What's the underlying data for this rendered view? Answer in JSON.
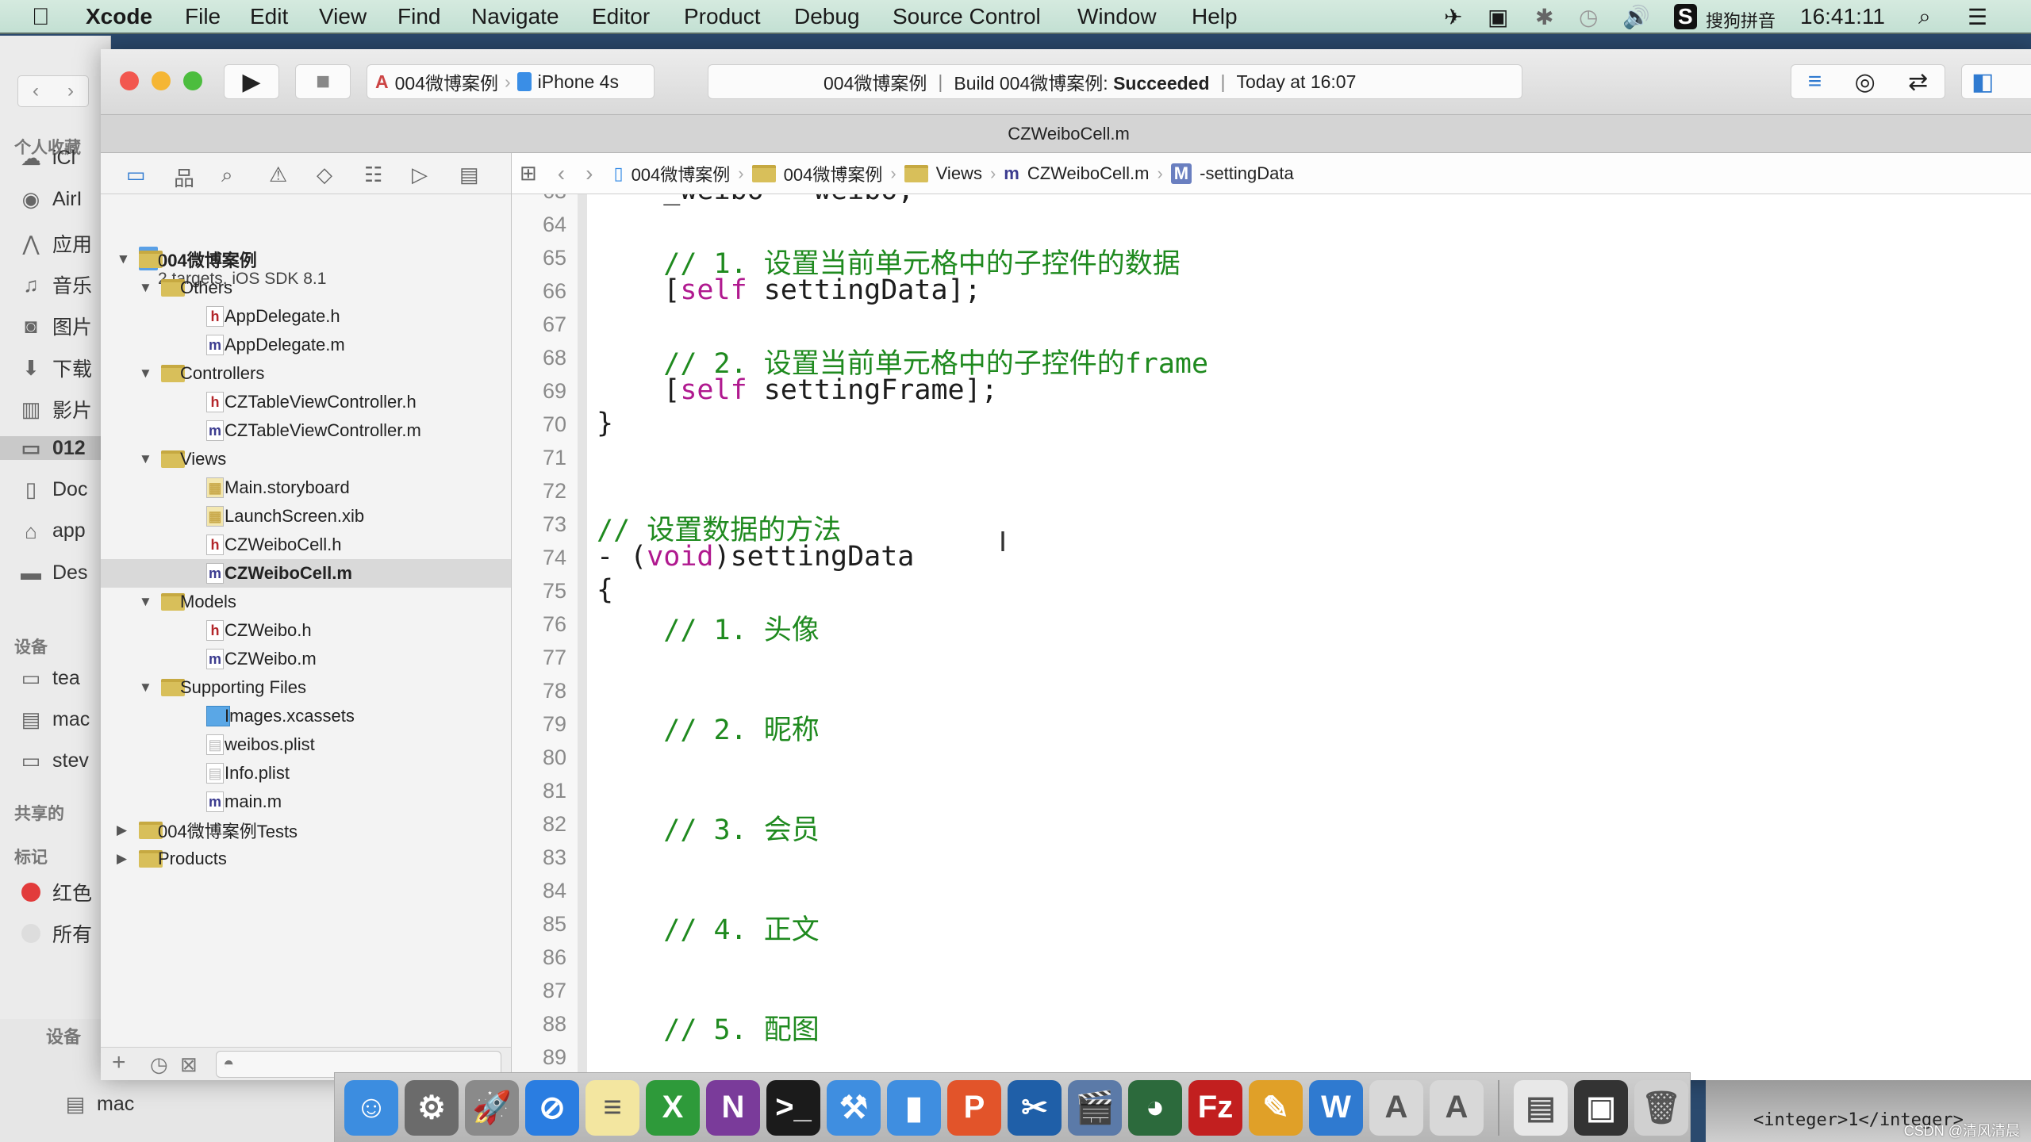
{
  "menubar": {
    "apple": "",
    "items": [
      "Xcode",
      "File",
      "Edit",
      "View",
      "Find",
      "Navigate",
      "Editor",
      "Product",
      "Debug",
      "Source Control",
      "Window",
      "Help"
    ],
    "input_method": "搜狗拼音",
    "clock": "16:41:11",
    "status_icons": [
      "airplane-icon",
      "screen-record-icon",
      "bluetooth-icon",
      "time-machine-icon",
      "volume-icon",
      "sogou-icon",
      "spotlight-icon",
      "notification-center-icon"
    ]
  },
  "finder_sidebar": {
    "favorites_header": "个人收藏",
    "favorites": [
      {
        "label": "iCl",
        "icon": "cloud-icon"
      },
      {
        "label": "AirI",
        "icon": "airdrop-icon"
      },
      {
        "label": "应用",
        "icon": "applications-icon"
      },
      {
        "label": "音乐",
        "icon": "music-icon"
      },
      {
        "label": "图片",
        "icon": "camera-icon"
      },
      {
        "label": "下载",
        "icon": "download-icon"
      },
      {
        "label": "影片",
        "icon": "film-icon"
      },
      {
        "label": "012",
        "icon": "folder-icon",
        "selected": true
      },
      {
        "label": "Doc",
        "icon": "documents-icon"
      },
      {
        "label": "app",
        "icon": "home-icon"
      },
      {
        "label": "Des",
        "icon": "desktop-icon"
      }
    ],
    "devices_header": "设备",
    "devices": [
      {
        "label": "tea",
        "icon": "monitor-icon"
      },
      {
        "label": "mac",
        "icon": "disk-icon"
      },
      {
        "label": "stev",
        "icon": "drive-icon"
      }
    ],
    "shared_header": "共享的",
    "tags_header": "标记",
    "tags": [
      {
        "label": "红色",
        "color": "#e23b3b"
      },
      {
        "label": "所有",
        "color": "#dddddd"
      }
    ]
  },
  "finder_window2": {
    "devices_header": "设备",
    "device": "mac"
  },
  "toolbar": {
    "scheme": "004微博案例",
    "device": "iPhone 4s",
    "status_project": "004微博案例",
    "status_build_prefix": "Build 004微博案例: ",
    "status_build_result": "Succeeded",
    "status_time": "Today at 16:07"
  },
  "tab_title": "CZWeiboCell.m",
  "jumpbar": {
    "items": [
      "004微博案例",
      "004微博案例",
      "Views",
      "CZWeiboCell.m",
      "-settingData"
    ]
  },
  "navigator": {
    "icons": [
      "project-navigator-icon",
      "symbol-navigator-icon",
      "find-navigator-icon",
      "issue-navigator-icon",
      "test-navigator-icon",
      "debug-navigator-icon",
      "breakpoint-navigator-icon",
      "report-navigator-icon"
    ],
    "project": {
      "name": "004微博案例",
      "subtitle": "2 targets, iOS SDK 8.1"
    },
    "rows": [
      {
        "label": "004微博案例",
        "depth": 1,
        "type": "folder",
        "open": true
      },
      {
        "label": "Others",
        "depth": 2,
        "type": "folder",
        "open": true
      },
      {
        "label": "AppDelegate.h",
        "depth": 3,
        "type": "h"
      },
      {
        "label": "AppDelegate.m",
        "depth": 3,
        "type": "m"
      },
      {
        "label": "Controllers",
        "depth": 2,
        "type": "folder",
        "open": true
      },
      {
        "label": "CZTableViewController.h",
        "depth": 3,
        "type": "h"
      },
      {
        "label": "CZTableViewController.m",
        "depth": 3,
        "type": "m"
      },
      {
        "label": "Views",
        "depth": 2,
        "type": "folder",
        "open": true
      },
      {
        "label": "Main.storyboard",
        "depth": 3,
        "type": "ib"
      },
      {
        "label": "LaunchScreen.xib",
        "depth": 3,
        "type": "ib"
      },
      {
        "label": "CZWeiboCell.h",
        "depth": 3,
        "type": "h"
      },
      {
        "label": "CZWeiboCell.m",
        "depth": 3,
        "type": "m",
        "selected": true
      },
      {
        "label": "Models",
        "depth": 2,
        "type": "folder",
        "open": true
      },
      {
        "label": "CZWeibo.h",
        "depth": 3,
        "type": "h"
      },
      {
        "label": "CZWeibo.m",
        "depth": 3,
        "type": "m"
      },
      {
        "label": "Supporting Files",
        "depth": 2,
        "type": "folder",
        "open": true
      },
      {
        "label": "Images.xcassets",
        "depth": 3,
        "type": "assets"
      },
      {
        "label": "weibos.plist",
        "depth": 3,
        "type": "plist"
      },
      {
        "label": "Info.plist",
        "depth": 3,
        "type": "plist"
      },
      {
        "label": "main.m",
        "depth": 3,
        "type": "m"
      },
      {
        "label": "004微博案例Tests",
        "depth": 1,
        "type": "folder",
        "open": false
      },
      {
        "label": "Products",
        "depth": 1,
        "type": "folder",
        "open": false
      }
    ]
  },
  "editor": {
    "lines": [
      {
        "n": "63",
        "t": [
          [
            "p",
            "    _weibo = weibo;"
          ]
        ]
      },
      {
        "n": "64",
        "t": []
      },
      {
        "n": "65",
        "t": [
          [
            "c",
            "    // 1. 设置当前单元格中的子控件的数据"
          ]
        ]
      },
      {
        "n": "66",
        "t": [
          [
            "p",
            "    ["
          ],
          [
            "k",
            "self"
          ],
          [
            "p",
            " settingData];"
          ]
        ]
      },
      {
        "n": "67",
        "t": []
      },
      {
        "n": "68",
        "t": [
          [
            "c",
            "    // 2. 设置当前单元格中的子控件的frame"
          ]
        ]
      },
      {
        "n": "69",
        "t": [
          [
            "p",
            "    ["
          ],
          [
            "k",
            "self"
          ],
          [
            "p",
            " settingFrame];"
          ]
        ]
      },
      {
        "n": "70",
        "t": [
          [
            "p",
            "}"
          ]
        ]
      },
      {
        "n": "71",
        "t": []
      },
      {
        "n": "72",
        "t": []
      },
      {
        "n": "73",
        "t": [
          [
            "c",
            "// 设置数据的方法"
          ]
        ]
      },
      {
        "n": "74",
        "t": [
          [
            "p",
            "- ("
          ],
          [
            "k",
            "void"
          ],
          [
            "p",
            ")settingData"
          ]
        ]
      },
      {
        "n": "75",
        "t": [
          [
            "p",
            "{"
          ]
        ]
      },
      {
        "n": "76",
        "t": [
          [
            "c",
            "    // 1. 头像"
          ]
        ]
      },
      {
        "n": "77",
        "t": []
      },
      {
        "n": "78",
        "t": []
      },
      {
        "n": "79",
        "t": [
          [
            "c",
            "    // 2. 昵称"
          ]
        ]
      },
      {
        "n": "80",
        "t": []
      },
      {
        "n": "81",
        "t": []
      },
      {
        "n": "82",
        "t": [
          [
            "c",
            "    // 3. 会员"
          ]
        ]
      },
      {
        "n": "83",
        "t": []
      },
      {
        "n": "84",
        "t": []
      },
      {
        "n": "85",
        "t": [
          [
            "c",
            "    // 4. 正文"
          ]
        ]
      },
      {
        "n": "86",
        "t": []
      },
      {
        "n": "87",
        "t": []
      },
      {
        "n": "88",
        "t": [
          [
            "c",
            "    // 5. 配图"
          ]
        ]
      },
      {
        "n": "89",
        "t": []
      }
    ]
  },
  "dock": {
    "apps": [
      {
        "name": "finder",
        "glyph": "☺",
        "color": "#3c8de0"
      },
      {
        "name": "system-preferences",
        "glyph": "⚙",
        "color": "#6b6b6b"
      },
      {
        "name": "launchpad",
        "glyph": "🚀",
        "color": "#8a8a8a"
      },
      {
        "name": "safari",
        "glyph": "⊘",
        "color": "#2a7de1"
      },
      {
        "name": "notes",
        "glyph": "≡",
        "color": "#f3e6a0"
      },
      {
        "name": "excel",
        "glyph": "X",
        "color": "#2e9a3a"
      },
      {
        "name": "onenote",
        "glyph": "N",
        "color": "#7a3b9a"
      },
      {
        "name": "terminal",
        "glyph": ">_",
        "color": "#1b1b1b"
      },
      {
        "name": "xcode",
        "glyph": "⚒",
        "color": "#3f8ee0"
      },
      {
        "name": "ios-simulator",
        "glyph": "▮",
        "color": "#3f8ee0"
      },
      {
        "name": "powerpoint",
        "glyph": "P",
        "color": "#e2542a"
      },
      {
        "name": "snip",
        "glyph": "✂",
        "color": "#1f5fa8"
      },
      {
        "name": "photo-booth",
        "glyph": "🎬",
        "color": "#5b7aa8"
      },
      {
        "name": "ftp-client",
        "glyph": "◕",
        "color": "#2c6a3c"
      },
      {
        "name": "filezilla",
        "glyph": "Fz",
        "color": "#c21f1f"
      },
      {
        "name": "sketch-tool",
        "glyph": "✎",
        "color": "#e0a028"
      },
      {
        "name": "word",
        "glyph": "W",
        "color": "#2f7ad0"
      },
      {
        "name": "app-installer-1",
        "glyph": "A",
        "color": "#d8d8d8"
      },
      {
        "name": "app-installer-2",
        "glyph": "A",
        "color": "#d8d8d8"
      },
      {
        "name": "downloads-stack",
        "glyph": "▤",
        "color": "#e8e8e8"
      },
      {
        "name": "documents-stack",
        "glyph": "▣",
        "color": "#333333"
      },
      {
        "name": "trash",
        "glyph": "🗑",
        "color": "#d0d0d0"
      }
    ]
  },
  "background_text": "<integer>1</integer>",
  "watermark": "CSDN @清风清晨",
  "colors": {
    "comment": "#1f8a1f",
    "keyword": "#b0198f",
    "selection": "#d9d9d9",
    "folder": "#d8bf5a"
  }
}
